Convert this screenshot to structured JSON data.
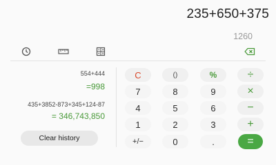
{
  "display": {
    "expression": "235+650+375",
    "preview": "1260"
  },
  "toolbar": {
    "history_icon": "clock-icon",
    "converter_icon": "ruler-icon",
    "scientific_icon": "calculator-grid-icon",
    "backspace_icon": "backspace-icon",
    "accent": "#4a9a3a"
  },
  "history": {
    "entries": [
      {
        "expression": "554+444",
        "result": "=998"
      },
      {
        "expression": "435+3852-873+345+124-87",
        "result": "= 346,743,850"
      }
    ],
    "clear_label": "Clear history"
  },
  "keys": {
    "clear": "C",
    "parens": "()",
    "percent": "%",
    "divide": "÷",
    "seven": "7",
    "eight": "8",
    "nine": "9",
    "multiply": "×",
    "four": "4",
    "five": "5",
    "six": "6",
    "minus": "−",
    "one": "1",
    "two": "2",
    "three": "3",
    "plus": "+",
    "sign": "+/−",
    "zero": "0",
    "decimal": ".",
    "equals": "="
  }
}
